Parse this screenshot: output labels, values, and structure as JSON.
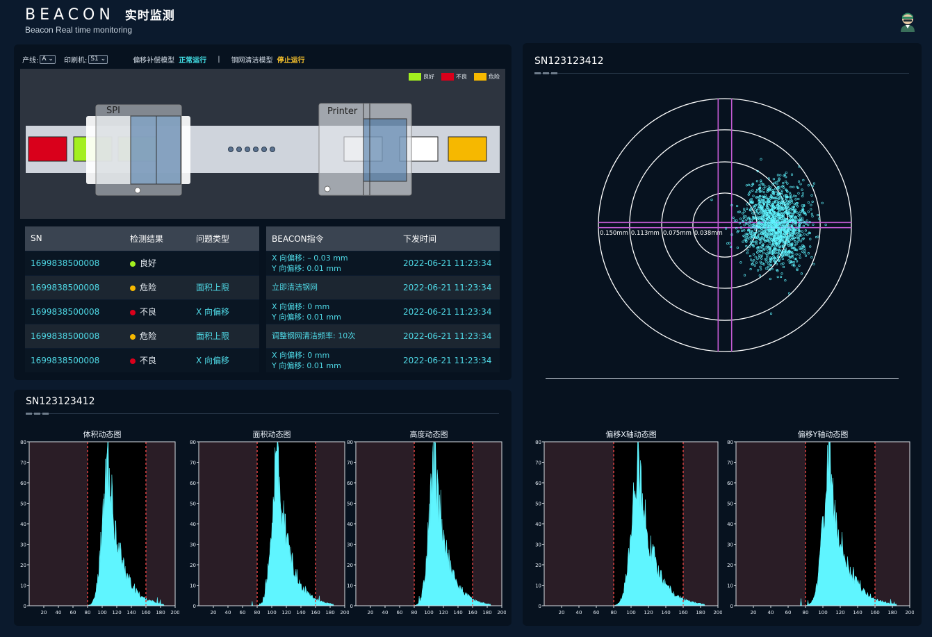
{
  "header": {
    "title": "BEACON",
    "title_cn": "实时监测",
    "subtitle": "Beacon Real time monitoring"
  },
  "controls": {
    "line_label": "产线:",
    "line_value": "A",
    "printer_label": "印刷机:",
    "printer_value": "S1",
    "offset_model_label": "偏移补偿模型",
    "offset_model_status": "正常运行",
    "separator": "|",
    "clean_model_label": "钢网清洁模型",
    "clean_model_status": "停止运行"
  },
  "scene": {
    "spi_label": "SPI",
    "printer_label": "Printer",
    "legend": [
      {
        "label": "良好",
        "color": "#a3ef1f"
      },
      {
        "label": "不良",
        "color": "#d9001b"
      },
      {
        "label": "危险",
        "color": "#f6b800"
      }
    ]
  },
  "sn_table": {
    "headers": [
      "SN",
      "检测结果",
      "问题类型"
    ],
    "rows": [
      {
        "sn": "1699838500008",
        "result": "良好",
        "status_color": "#a3ef1f",
        "issue": ""
      },
      {
        "sn": "1699838500008",
        "result": "危险",
        "status_color": "#f6b800",
        "issue": "面积上限"
      },
      {
        "sn": "1699838500008",
        "result": "不良",
        "status_color": "#d9001b",
        "issue": "X 向偏移"
      },
      {
        "sn": "1699838500008",
        "result": "危险",
        "status_color": "#f6b800",
        "issue": "面积上限"
      },
      {
        "sn": "1699838500008",
        "result": "不良",
        "status_color": "#d9001b",
        "issue": "X 向偏移"
      }
    ]
  },
  "cmd_table": {
    "headers": [
      "BEACON指令",
      "下发时间"
    ],
    "rows": [
      {
        "line1": "X 向偏移: – 0.03 mm",
        "line2": "Y 向偏移: 0.01 mm",
        "time": "2022-06-21 11:23:34"
      },
      {
        "line1": "立即清洁钢网",
        "line2": "",
        "time": "2022-06-21 11:23:34"
      },
      {
        "line1": "X 向偏移: 0 mm",
        "line2": "Y 向偏移: 0.01 mm",
        "time": "2022-06-21 11:23:34"
      },
      {
        "line1": "调整钢网清洁频率: 10次",
        "line2": "",
        "time": "2022-06-21 11:23:34"
      },
      {
        "line1": "X 向偏移: 0 mm",
        "line2": "Y 向偏移: 0.01 mm",
        "time": "2022-06-21 11:23:34"
      }
    ]
  },
  "hist_section": {
    "title": "SN123123412"
  },
  "right_section": {
    "title": "SN123123412"
  },
  "colors": {
    "accent": "#5ff5ff",
    "spec_line": "#d94040",
    "crosshair": "#c25ad2"
  },
  "chart_data": [
    {
      "type": "scatter",
      "title": "",
      "ring_labels": [
        "0.150mm",
        "0.113mm",
        "0.075mm",
        "0.038mm"
      ],
      "ring_values": [
        0.15,
        0.113,
        0.075,
        0.038
      ],
      "crosshair_x": [
        -0.008,
        0.008
      ],
      "crosshair_y": [
        -0.003,
        0.003
      ],
      "cluster_center": [
        0.06,
        0.0
      ],
      "cluster_spread": 0.024,
      "n_points": 1400
    },
    {
      "type": "area",
      "title": "体积动态图",
      "xlim": [
        0,
        200
      ],
      "ylim": [
        0,
        80
      ],
      "xticks": [
        20,
        40,
        60,
        80,
        100,
        120,
        140,
        160,
        180,
        200
      ],
      "yticks": [
        0,
        10,
        20,
        30,
        40,
        50,
        60,
        70,
        80
      ],
      "spec_limits": [
        80,
        160
      ],
      "peak_x": 108,
      "peak_y": 80,
      "range": [
        70,
        185
      ]
    },
    {
      "type": "area",
      "title": "面积动态图",
      "xlim": [
        0,
        200
      ],
      "ylim": [
        0,
        80
      ],
      "xticks": [
        20,
        40,
        60,
        80,
        100,
        120,
        140,
        160,
        180,
        200
      ],
      "yticks": [
        0,
        10,
        20,
        30,
        40,
        50,
        60,
        70,
        80
      ],
      "spec_limits": [
        80,
        160
      ],
      "peak_x": 108,
      "peak_y": 80,
      "range": [
        70,
        185
      ]
    },
    {
      "type": "area",
      "title": "高度动态图",
      "xlim": [
        0,
        200
      ],
      "ylim": [
        0,
        80
      ],
      "xticks": [
        20,
        40,
        60,
        80,
        100,
        120,
        140,
        160,
        180,
        200
      ],
      "yticks": [
        0,
        10,
        20,
        30,
        40,
        50,
        60,
        70,
        80
      ],
      "spec_limits": [
        80,
        160
      ],
      "peak_x": 108,
      "peak_y": 80,
      "range": [
        70,
        185
      ]
    },
    {
      "type": "area",
      "title": "偏移X轴动态图",
      "xlim": [
        0,
        200
      ],
      "ylim": [
        0,
        80
      ],
      "xticks": [
        20,
        40,
        60,
        80,
        100,
        120,
        140,
        160,
        180,
        200
      ],
      "yticks": [
        0,
        10,
        20,
        30,
        40,
        50,
        60,
        70,
        80
      ],
      "spec_limits": [
        80,
        160
      ],
      "peak_x": 108,
      "peak_y": 80,
      "range": [
        70,
        185
      ]
    },
    {
      "type": "area",
      "title": "偏移Y轴动态图",
      "xlim": [
        0,
        200
      ],
      "ylim": [
        0,
        80
      ],
      "xticks": [
        20,
        40,
        60,
        80,
        100,
        120,
        140,
        160,
        180,
        200
      ],
      "yticks": [
        0,
        10,
        20,
        30,
        40,
        50,
        60,
        70,
        80
      ],
      "spec_limits": [
        80,
        160
      ],
      "peak_x": 108,
      "peak_y": 80,
      "range": [
        70,
        185
      ]
    }
  ]
}
